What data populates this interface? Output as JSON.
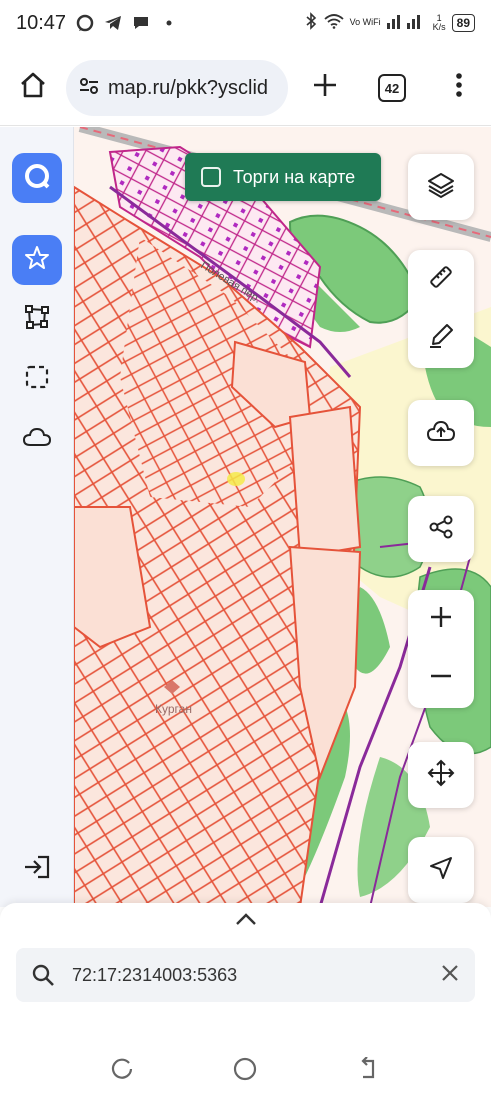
{
  "status_bar": {
    "time": "10:47",
    "network_label": "Vo WiFi",
    "speed": "1",
    "speed_unit": "K/s",
    "battery": "89"
  },
  "browser": {
    "url": "map.ru/pkk?ysclid",
    "tab_count": "42",
    "icons": [
      "home-icon",
      "site-settings-icon",
      "plus-icon",
      "tabs-icon",
      "more-vert-icon"
    ]
  },
  "map": {
    "auction_toggle_label": "Торги на карте",
    "auction_toggle_checked": false,
    "street_label": "Полевая пер.",
    "place_label": "Курган"
  },
  "left_toolbar": {
    "items": [
      "app-logo-icon",
      "favorites-star-icon",
      "polygon-icon",
      "select-area-icon",
      "cloud-icon",
      "login-icon"
    ]
  },
  "right_controls": {
    "items": [
      "layers-icon",
      "ruler-icon",
      "edit-icon",
      "upload-cloud-icon",
      "share-icon",
      "zoom-in-icon",
      "zoom-out-icon",
      "move-icon",
      "locate-icon"
    ]
  },
  "search": {
    "value": "72:17:2314003:5363"
  },
  "colors": {
    "accent": "#4a7ef5",
    "auction_green": "#1f7a55",
    "parcel_line": "#e5533a",
    "park_green": "#7cc97a"
  }
}
